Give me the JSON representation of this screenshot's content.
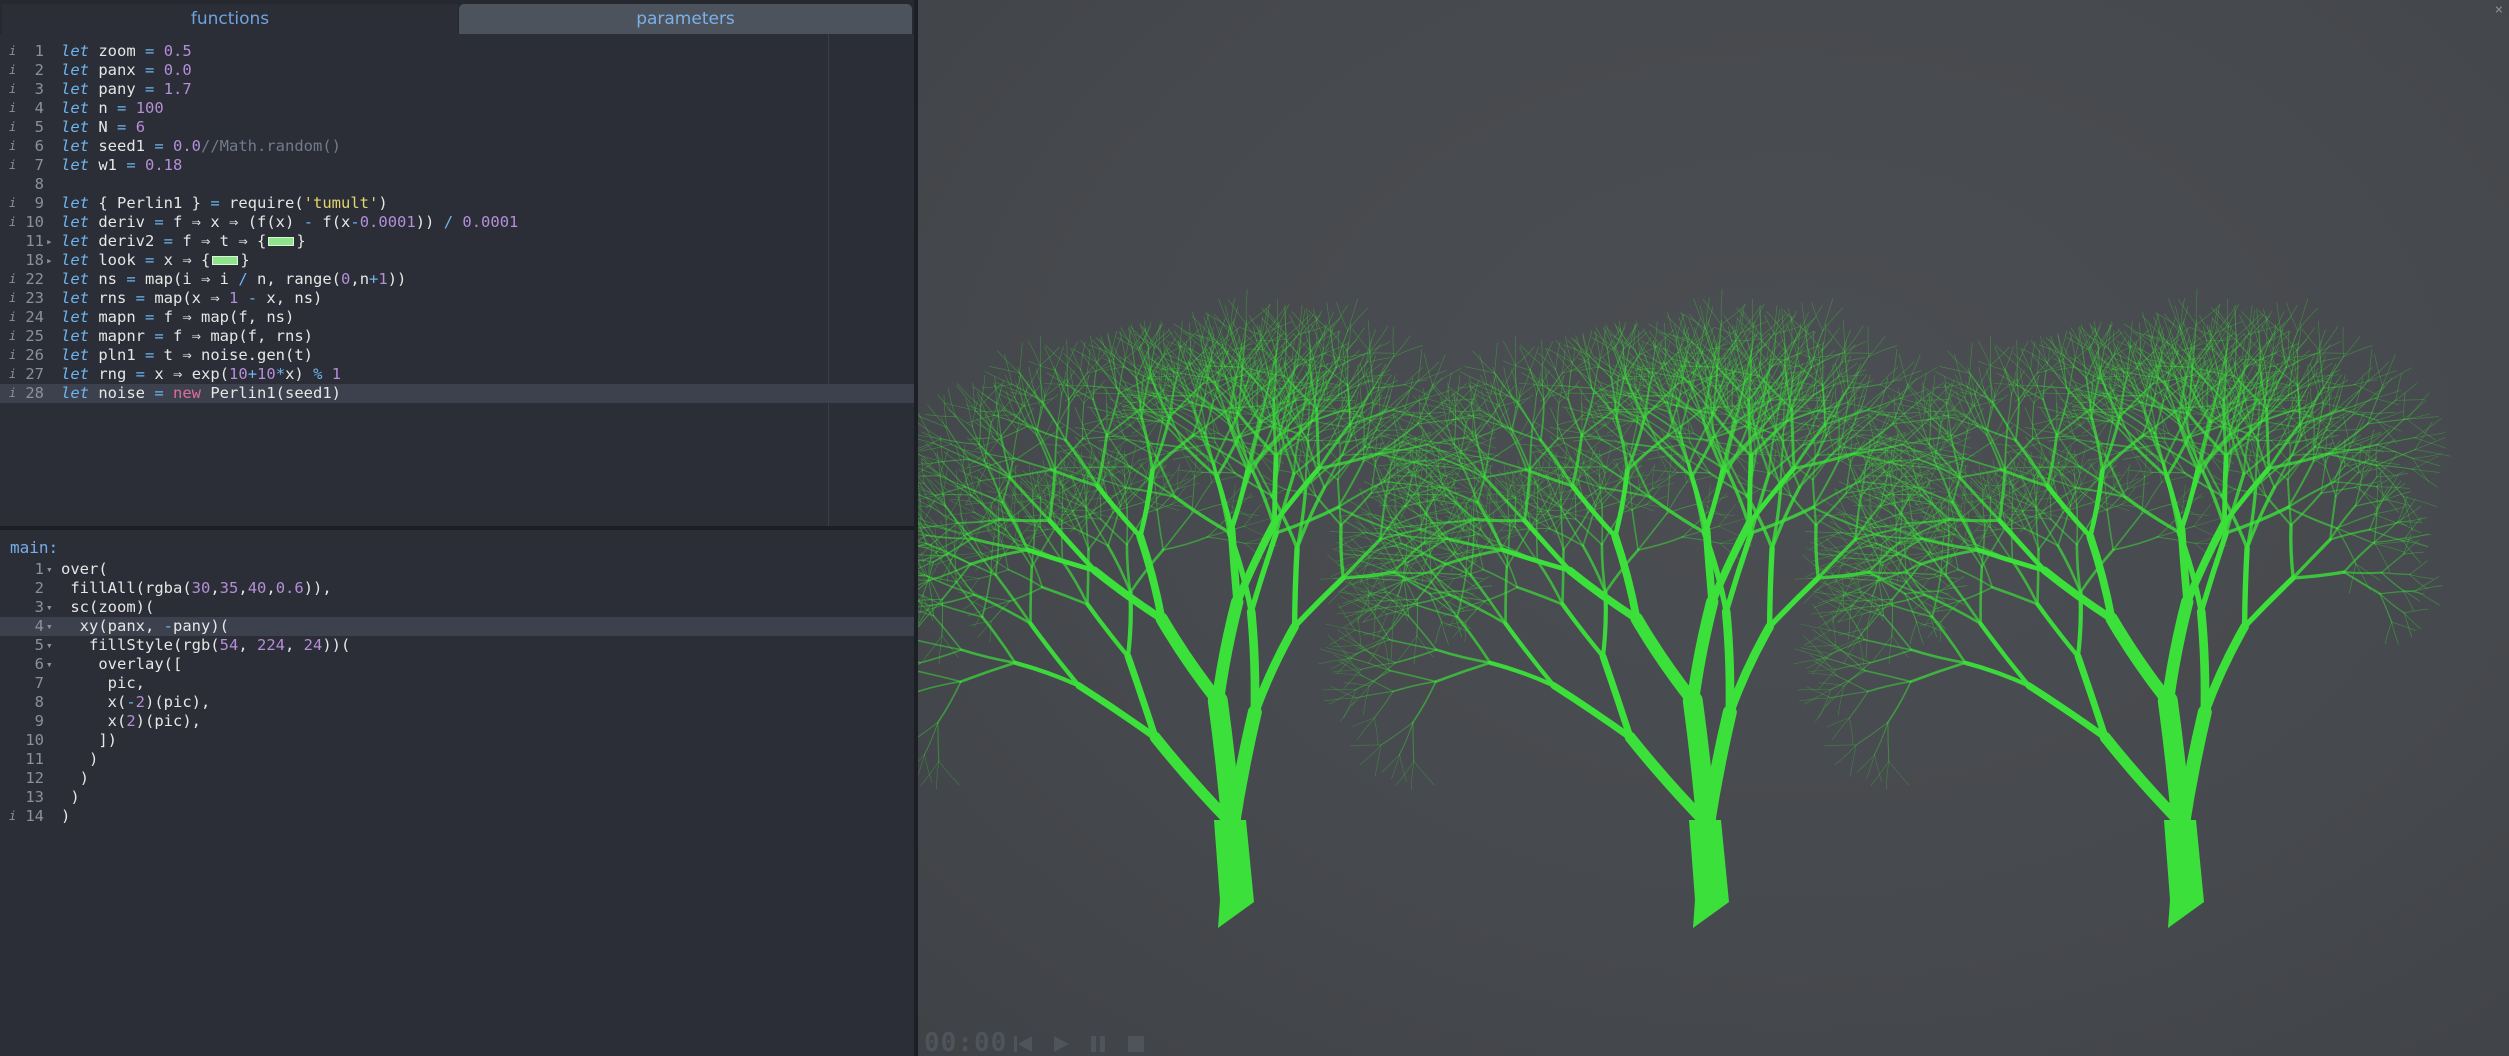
{
  "tabs": {
    "functions": "functions",
    "parameters": "parameters"
  },
  "functions_editor": {
    "lines": [
      {
        "n": "1",
        "info": true,
        "fold": "",
        "html": "<span class='kw'>let</span> zoom <span class='op'>=</span> <span class='num'>0.5</span>"
      },
      {
        "n": "2",
        "info": true,
        "fold": "",
        "html": "<span class='kw'>let</span> panx <span class='op'>=</span> <span class='num'>0.0</span>"
      },
      {
        "n": "3",
        "info": true,
        "fold": "",
        "html": "<span class='kw'>let</span> pany <span class='op'>=</span> <span class='num'>1.7</span>"
      },
      {
        "n": "4",
        "info": true,
        "fold": "",
        "html": "<span class='kw'>let</span> n <span class='op'>=</span> <span class='num'>100</span>"
      },
      {
        "n": "5",
        "info": true,
        "fold": "",
        "html": "<span class='kw'>let</span> N <span class='op'>=</span> <span class='num'>6</span>"
      },
      {
        "n": "6",
        "info": true,
        "fold": "",
        "html": "<span class='kw'>let</span> seed1 <span class='op'>=</span> <span class='num'>0.0</span><span class='cmt'>//Math.random()</span>"
      },
      {
        "n": "7",
        "info": true,
        "fold": "",
        "html": "<span class='kw'>let</span> w1 <span class='op'>=</span> <span class='num'>0.18</span>"
      },
      {
        "n": "8",
        "info": false,
        "fold": "",
        "html": ""
      },
      {
        "n": "9",
        "info": true,
        "fold": "",
        "html": "<span class='kw'>let</span> { Perlin1 } <span class='op'>=</span> require(<span class='str'>'tumult'</span>)"
      },
      {
        "n": "10",
        "info": true,
        "fold": "",
        "html": "<span class='kw'>let</span> deriv <span class='op'>=</span> f <span class='arr'>⇒</span> x <span class='arr'>⇒</span> (f(x) <span class='op'>-</span> f(x<span class='op'>-</span><span class='num'>0.0001</span>)) <span class='op'>/</span> <span class='num'>0.0001</span>"
      },
      {
        "n": "11",
        "info": false,
        "fold": "▸",
        "html": "<span class='kw'>let</span> deriv2 <span class='op'>=</span> f <span class='arr'>⇒</span> t <span class='arr'>⇒</span> {<span class='fold-chip'></span>}"
      },
      {
        "n": "18",
        "info": false,
        "fold": "▸",
        "html": "<span class='kw'>let</span> look <span class='op'>=</span> x <span class='arr'>⇒</span> {<span class='fold-chip'></span>}"
      },
      {
        "n": "22",
        "info": true,
        "fold": "",
        "html": "<span class='kw'>let</span> ns <span class='op'>=</span> map(i <span class='arr'>⇒</span> i <span class='op'>/</span> n, range(<span class='num'>0</span>,n<span class='op'>+</span><span class='num'>1</span>))"
      },
      {
        "n": "23",
        "info": true,
        "fold": "",
        "html": "<span class='kw'>let</span> rns <span class='op'>=</span> map(x <span class='arr'>⇒</span> <span class='num'>1</span> <span class='op'>-</span> x, ns)"
      },
      {
        "n": "24",
        "info": true,
        "fold": "",
        "html": "<span class='kw'>let</span> mapn <span class='op'>=</span> f <span class='arr'>⇒</span> map(f, ns)"
      },
      {
        "n": "25",
        "info": true,
        "fold": "",
        "html": "<span class='kw'>let</span> mapnr <span class='op'>=</span> f <span class='arr'>⇒</span> map(f, rns)"
      },
      {
        "n": "26",
        "info": true,
        "fold": "",
        "html": "<span class='kw'>let</span> pln1 <span class='op'>=</span> t <span class='arr'>⇒</span> noise.gen(t)"
      },
      {
        "n": "27",
        "info": true,
        "fold": "",
        "html": "<span class='kw'>let</span> rng <span class='op'>=</span> x <span class='arr'>⇒</span> exp(<span class='num'>10</span><span class='op'>+</span><span class='num'>10</span><span class='op'>*</span>x) <span class='op'>%</span> <span class='num'>1</span>"
      },
      {
        "n": "28",
        "info": true,
        "fold": "",
        "active": true,
        "html": "<span class='kw'>let</span> noise <span class='op'>=</span> <span class='new'>new</span> Perlin1(seed1)"
      }
    ]
  },
  "main_editor": {
    "label": "main:",
    "lines": [
      {
        "n": "1",
        "info": false,
        "fold": "▾",
        "html": "over("
      },
      {
        "n": "2",
        "info": false,
        "fold": "",
        "html": " fillAll(rgba(<span class='num'>30</span>,<span class='num'>35</span>,<span class='num'>40</span>,<span class='num'>0.6</span>)),"
      },
      {
        "n": "3",
        "info": false,
        "fold": "▾",
        "html": " sc(zoom)("
      },
      {
        "n": "4",
        "info": false,
        "fold": "▾",
        "active": true,
        "html": "  xy(panx, <span class='op'>-</span>pany)("
      },
      {
        "n": "5",
        "info": false,
        "fold": "▾",
        "html": "   fillStyle(rgb(<span class='num'>54</span>, <span class='num'>224</span>, <span class='num'>24</span>))("
      },
      {
        "n": "6",
        "info": false,
        "fold": "▾",
        "html": "    overlay(["
      },
      {
        "n": "7",
        "info": false,
        "fold": "",
        "html": "     pic,"
      },
      {
        "n": "8",
        "info": false,
        "fold": "",
        "html": "     x(<span class='op'>-</span><span class='num'>2</span>)(pic),"
      },
      {
        "n": "9",
        "info": false,
        "fold": "",
        "html": "     x(<span class='num'>2</span>)(pic),"
      },
      {
        "n": "10",
        "info": false,
        "fold": "",
        "html": "    ])"
      },
      {
        "n": "11",
        "info": false,
        "fold": "",
        "html": "   )"
      },
      {
        "n": "12",
        "info": false,
        "fold": "",
        "html": "  )"
      },
      {
        "n": "13",
        "info": false,
        "fold": "",
        "html": " )"
      },
      {
        "n": "14",
        "info": true,
        "fold": "",
        "html": ")"
      }
    ]
  },
  "canvas": {
    "fill_color": "#3be03a",
    "background": "#46494d",
    "close_glyph": "×"
  },
  "playback": {
    "timecode": "00:00",
    "buttons": [
      "rewind-icon",
      "play-icon",
      "pause-icon",
      "stop-icon"
    ]
  }
}
